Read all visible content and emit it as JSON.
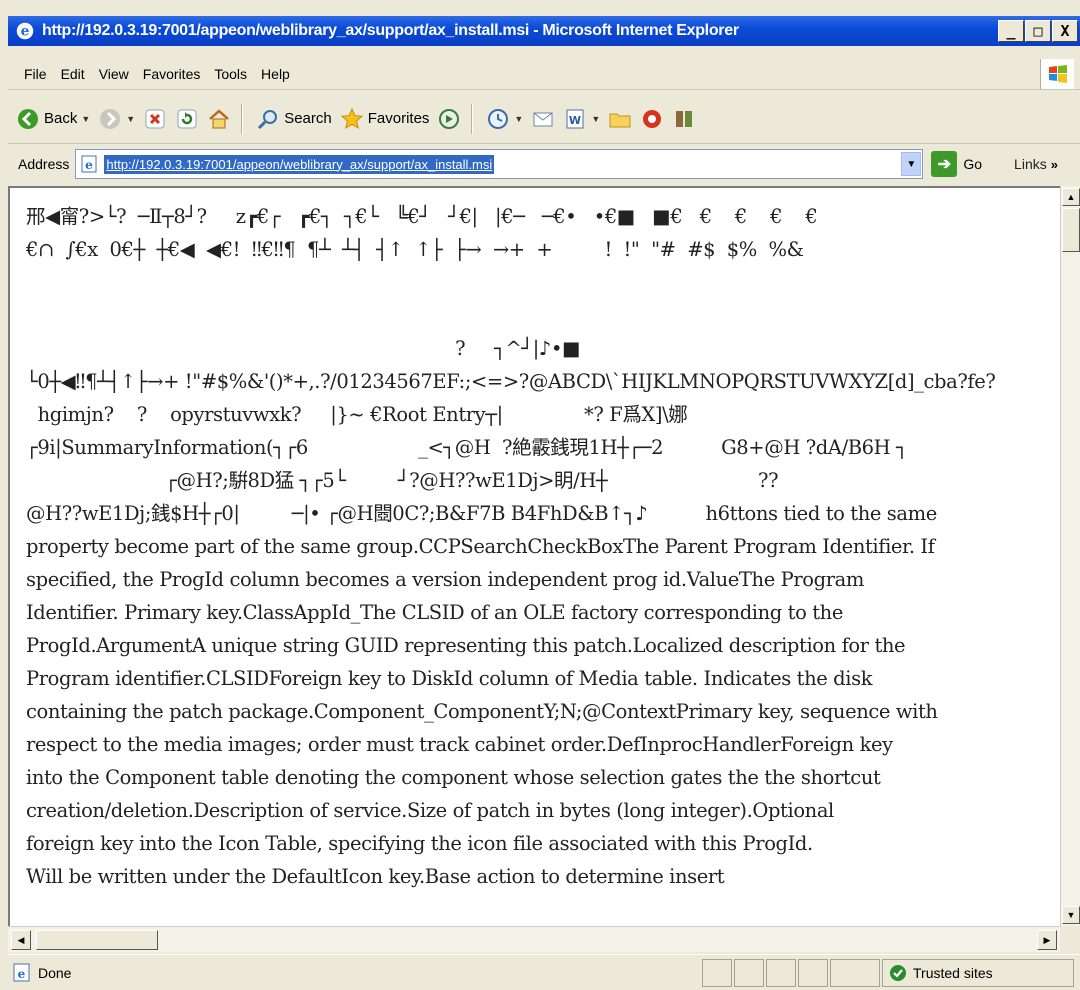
{
  "window": {
    "title": "http://192.0.3.19:7001/appeon/weblibrary_ax/support/ax_install.msi - Microsoft Internet Explorer",
    "controls": [
      "_",
      "□",
      "X"
    ]
  },
  "menu": [
    "File",
    "Edit",
    "View",
    "Favorites",
    "Tools",
    "Help"
  ],
  "toolbar": {
    "back_label": "Back",
    "search_label": "Search",
    "favorites_label": "Favorites"
  },
  "address": {
    "label": "Address",
    "url": "http://192.0.3.19:7001/appeon/weblibrary_ax/support/ax_install.msi",
    "go_label": "Go",
    "links_label": "Links",
    "links_chevron": "»"
  },
  "content": {
    "text": "邢◀甯?>└?  ─Ⅱ┬8┘?     z┏€┌   ┏€┐  ┐€└   ╚€┘   ┘€|   |€─   ─€•   •€■   ■€   €    €    €    €\n€∩  ∫€x  0€┼  ┼€◀  ◀€!  ‼€‼¶  ¶┴  ┴┤  ┤↑  ↑├  ├→  →+  +         !  !\"  \"#  #$  $%  %&\n\n\n                                                                          ?     ┐^┘|♪•■\n└0┼◀‼¶┴┤↑├→+ !\"#$%&'()*+,.?/01234567EF:;<=>?@ABCD\\`HIJKLMNOPQRSTUVWXYZ[d]_cba?fe?\n  hgimjn?    ?    opyrstuvwxk?     |}~ €Root Entry┬|              *? F爲X]\\娜\n┌9i|SummaryInformation(┐┌6                   _<┐@H  ?絶霰銭現1H┼┌─2          G8+@H ?dA/B6H ┐\n                        ┌@H?;騈8D猛 ┐┌5└         ┘?@H??wE1Dj>眀/H┼                          ??\n@H??wE1Dj;銭$H┼┌0|         ─|• ┌@H閸0C?;B&F7B B4FhD&B↑┐♪          h6ttons tied to the same\nproperty become part of the same group.CCPSearchCheckBoxThe Parent Program Identifier. If\nspecified, the ProgId column becomes a version independent prog id.ValueThe Program\nIdentifier. Primary key.ClassAppId_The CLSID of an OLE factory corresponding to the\nProgId.ArgumentA unique string GUID representing this patch.Localized description for the\nProgram identifier.CLSIDForeign key to DiskId column of Media table. Indicates the disk\ncontaining the patch package.Component_ComponentY;N;@ContextPrimary key, sequence with\nrespect to the media images; order must track cabinet order.DefInprocHandlerForeign key\ninto the Component table denoting the component whose selection gates the the shortcut\ncreation/deletion.Description of service.Size of patch in bytes (long integer).Optional\nforeign key into the Icon Table, specifying the icon file associated with this ProgId.\nWill be written under the DefaultIcon key.Base action to determine insert"
  },
  "status": {
    "text": "Done",
    "zone": "Trusted sites"
  },
  "colors": {
    "titlebar": "#0a4bd8",
    "selection": "#316ac5",
    "chrome": "#ece9d8"
  }
}
